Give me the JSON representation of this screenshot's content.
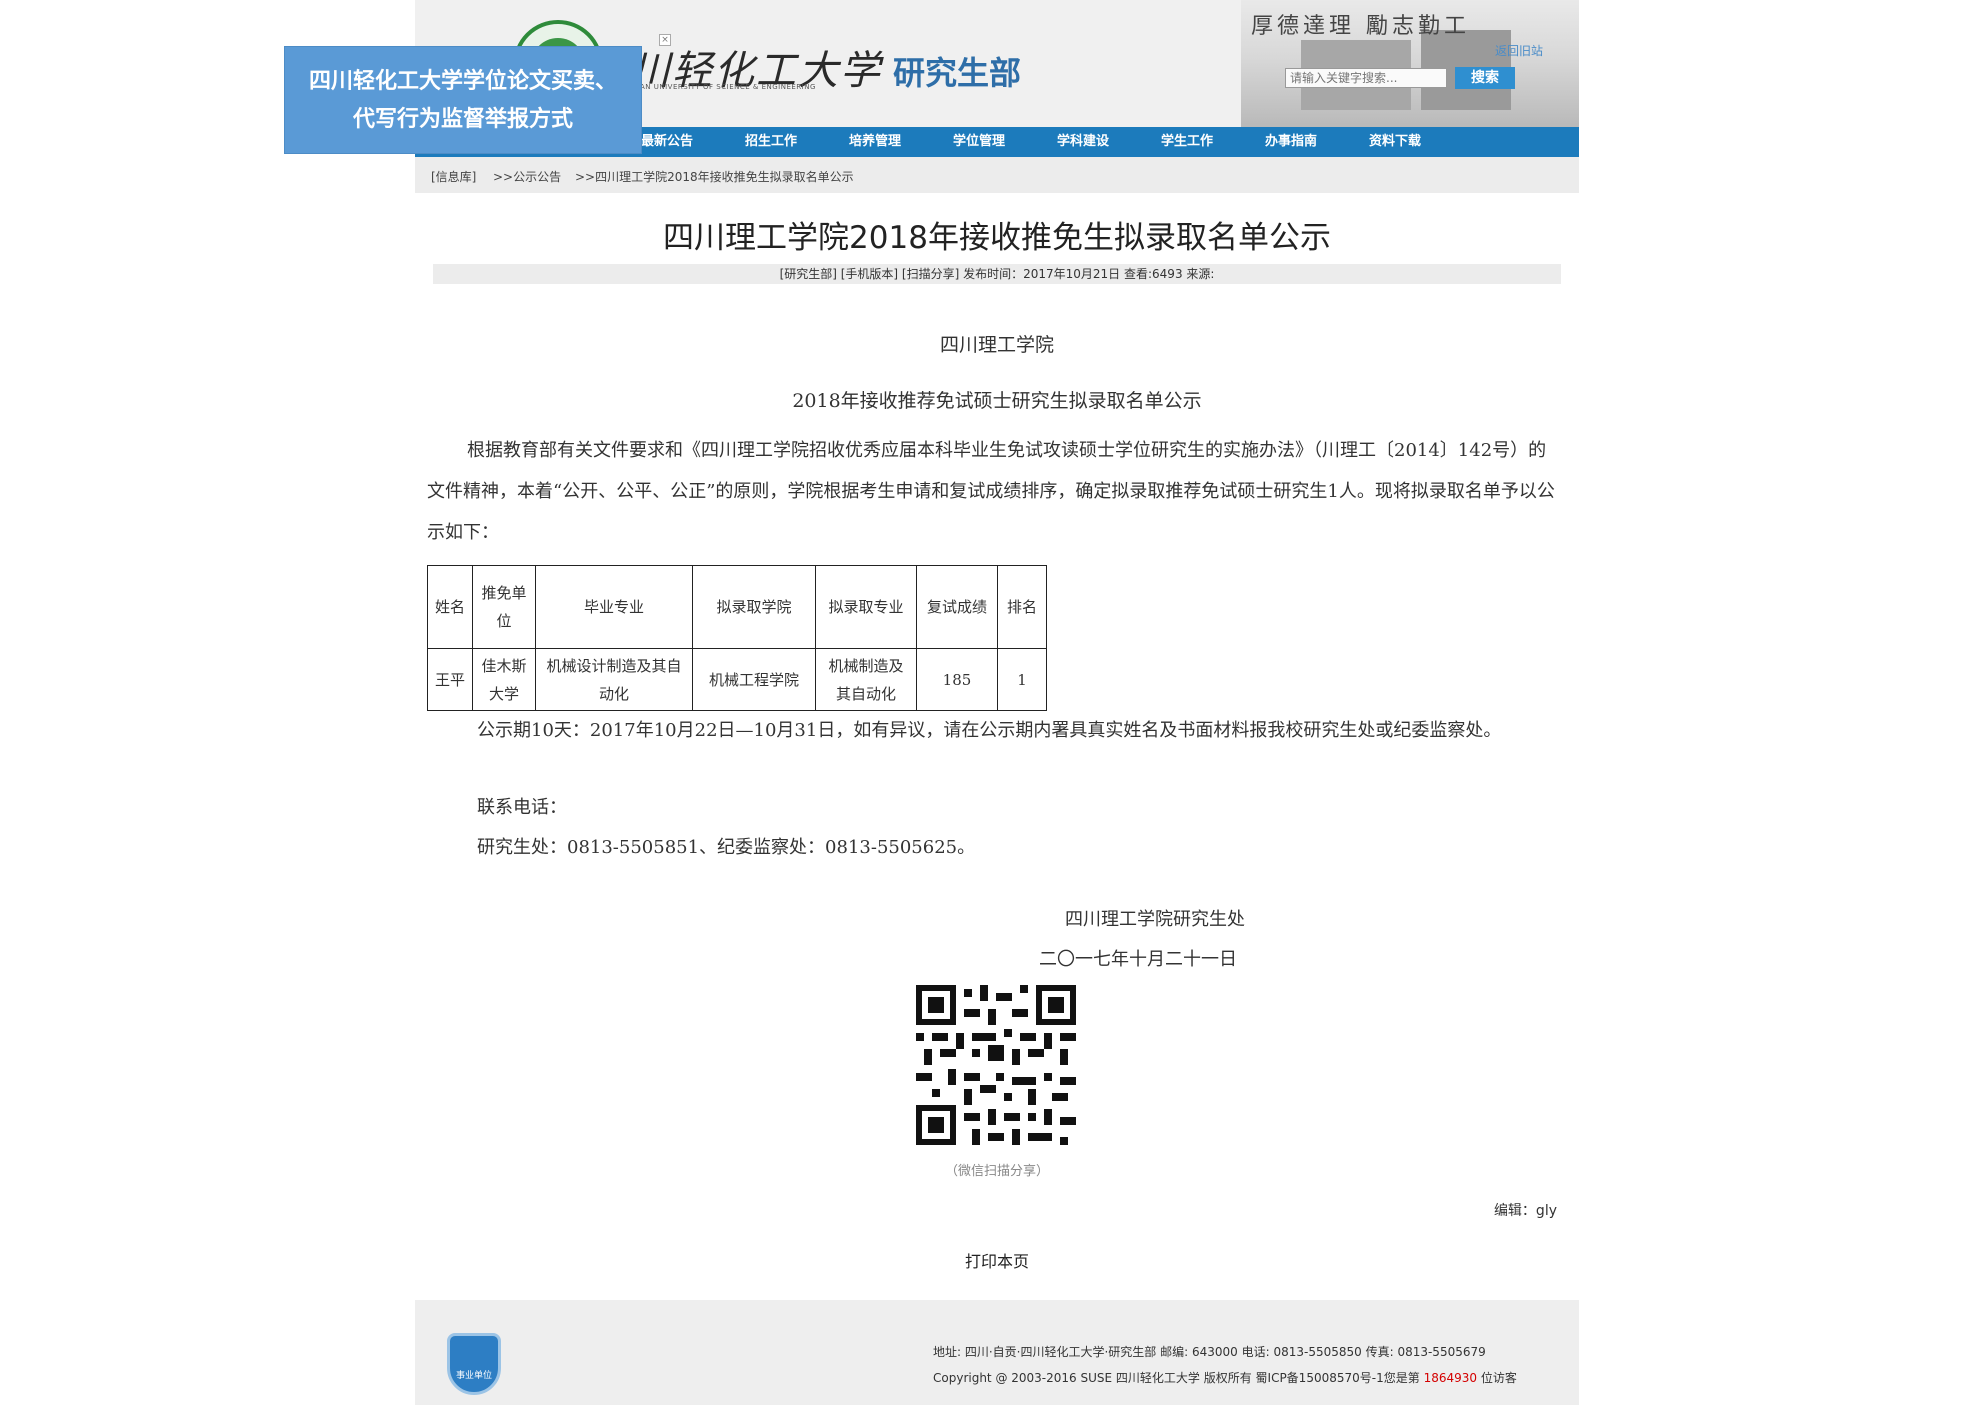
{
  "overlay": {
    "line1": "四川轻化工大学学位论文买卖、",
    "line2": "代写行为监督举报方式"
  },
  "header": {
    "logo_text": "川轻化工大学",
    "logo_sub": "AN UNIVERSITY OF SCIENCE & ENGINEERING",
    "dept_title": "研究生部",
    "motto": "厚德達理 勵志勤工",
    "back_link": "返回旧站",
    "search_placeholder": "请输入关键字搜索...",
    "search_button": "搜索"
  },
  "nav": [
    "最新公告",
    "招生工作",
    "培养管理",
    "学位管理",
    "学科建设",
    "学生工作",
    "办事指南",
    "资料下载"
  ],
  "breadcrumb": [
    "[信息库]",
    ">>公示公告",
    ">>四川理工学院2018年接收推免生拟录取名单公示"
  ],
  "article": {
    "title": "四川理工学院2018年接收推免生拟录取名单公示",
    "meta": "[研究生部]  [手机版本]  [扫描分享]  发布时间：2017年10月21日  查看:6493  来源:",
    "org": "四川理工学院",
    "subtitle": "2018年接收推荐免试硕士研究生拟录取名单公示",
    "intro": "根据教育部有关文件要求和《四川理工学院招收优秀应届本科毕业生免试攻读硕士学位研究生的实施办法》（川理工〔2014〕142号）的文件精神，本着“公开、公平、公正”的原则，学院根据考生申请和复试成绩排序，确定拟录取推荐免试硕士研究生1人。现将拟录取名单予以公示如下：",
    "table": {
      "headers": [
        "姓名",
        "推免单位",
        "毕业专业",
        "拟录取学院",
        "拟录取专业",
        "复试成绩",
        "排名"
      ],
      "rows": [
        [
          "王平",
          "佳木斯大学",
          "机械设计制造及其自动化",
          "机械工程学院",
          "机械制造及其自动化",
          "185",
          "1"
        ]
      ]
    },
    "notice": "公示期10天：2017年10月22日—10月31日，如有异议，请在公示期内署具真实姓名及书面材料报我校研究生处或纪委监察处。",
    "contact_label": "联系电话：",
    "contact_numbers": "研究生处：0813-5505851、纪委监察处：0813-5505625。",
    "signature": "四川理工学院研究生处",
    "date": "二〇一七年十月二十一日",
    "qr_caption": "（微信扫描分享）",
    "editor": "编辑：gly",
    "print": "打印本页"
  },
  "footer": {
    "address": "地址: 四川·自贡·四川轻化工大学·研究生部      邮编: 643000      电话: 0813-5505850      传真: 0813-5505679",
    "copyright": "Copyright @ 2003-2016 SUSE 四川轻化工大学 版权所有 蜀ICP备15008570号-1",
    "visitor_prefix": "您是第",
    "visitor_count": "1864930",
    "visitor_suffix": "位访客",
    "badge": "事业单位"
  },
  "colors": {
    "nav_bg": "#1c7bbc",
    "dept_title": "#2e6ea8",
    "overlay_bg": "#5a9ad6",
    "visitor_count": "#d40000"
  }
}
